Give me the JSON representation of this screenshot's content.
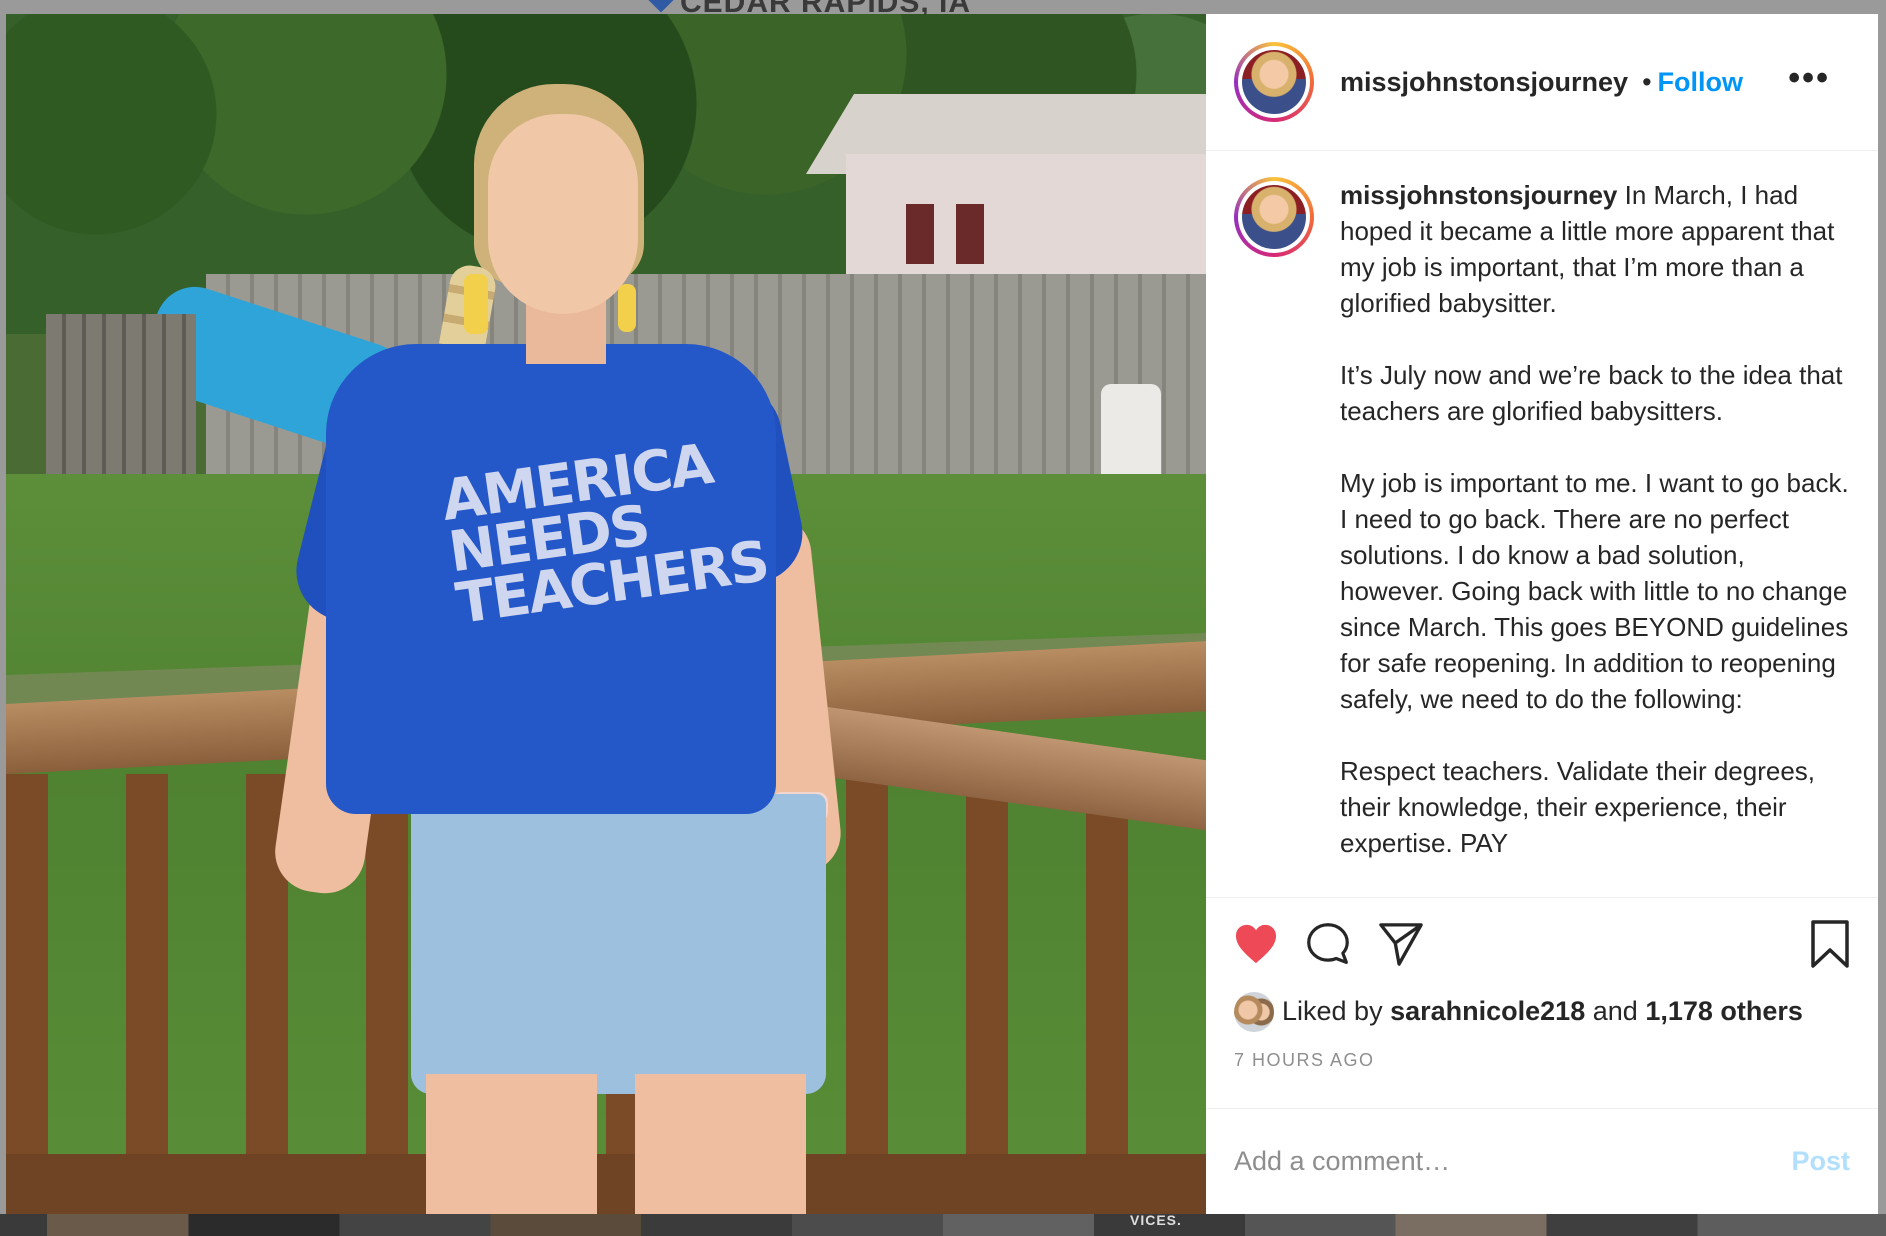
{
  "background": {
    "location": "CEDAR RAPIDS, IA",
    "strip_text": "VICES."
  },
  "photo": {
    "shirt_lines": [
      "AMERICA",
      "NEEDS",
      "TEACHERS"
    ]
  },
  "header": {
    "username": "missjohnstonsjourney",
    "separator": "•",
    "follow_label": "Follow",
    "more_label": "•••"
  },
  "caption": {
    "username": "missjohnstonsjourney",
    "text": " In March, I had hoped it became a little more apparent that my job is important, that I’m more than a glorified babysitter.\n\nIt’s July now and we’re back to the idea that teachers are glorified babysitters.\n\nMy job is important to me. I want to go back. I need to go back. There are no perfect solutions. I do know a bad solution, however. Going back with little to no change since March. This goes BEYOND guidelines for safe reopening. In addition to reopening safely, we need to do the following:\n\nRespect teachers. Validate their degrees, their knowledge, their experience, their expertise. PAY"
  },
  "actions": {
    "icons": [
      "heart-icon",
      "comment-icon",
      "share-icon",
      "bookmark-icon"
    ],
    "liked": true,
    "heart_color": "#ed4956"
  },
  "likes": {
    "prefix": "Liked by",
    "user": "sarahnicole218",
    "conjunction": "and",
    "others": "1,178 others"
  },
  "timestamp": "7 HOURS AGO",
  "comment": {
    "placeholder": "Add a comment…",
    "post_label": "Post"
  },
  "colors": {
    "link_blue": "#0095f6",
    "post_disabled": "#b2dffc",
    "muted_text": "#8e8e8e"
  }
}
